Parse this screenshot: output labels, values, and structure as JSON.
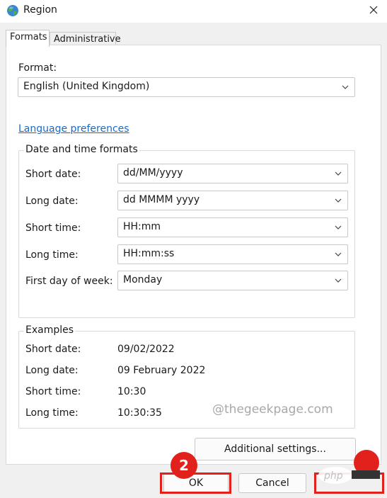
{
  "window": {
    "title": "Region"
  },
  "tabs": [
    {
      "label": "Formats",
      "active": true
    },
    {
      "label": "Administrative",
      "active": false
    }
  ],
  "format": {
    "label": "Format:",
    "value": "English (United Kingdom)"
  },
  "language_link": "Language preferences",
  "date_time_formats": {
    "legend": "Date and time formats",
    "rows": [
      {
        "label": "Short date:",
        "value": "dd/MM/yyyy"
      },
      {
        "label": "Long date:",
        "value": "dd MMMM yyyy"
      },
      {
        "label": "Short time:",
        "value": "HH:mm"
      },
      {
        "label": "Long time:",
        "value": "HH:mm:ss"
      },
      {
        "label": "First day of week:",
        "value": "Monday"
      }
    ]
  },
  "examples": {
    "legend": "Examples",
    "rows": [
      {
        "label": "Short date:",
        "value": "09/02/2022"
      },
      {
        "label": "Long date:",
        "value": "09 February 2022"
      },
      {
        "label": "Short time:",
        "value": "10:30"
      },
      {
        "label": "Long time:",
        "value": "10:30:35"
      }
    ]
  },
  "watermark": "@thegeekpage.com",
  "buttons": {
    "additional": "Additional settings...",
    "ok": "OK",
    "cancel": "Cancel"
  },
  "annotations": {
    "step_ok": "2"
  },
  "colors": {
    "accent_link": "#1a6bc4",
    "annotation_red": "#e3211c"
  }
}
